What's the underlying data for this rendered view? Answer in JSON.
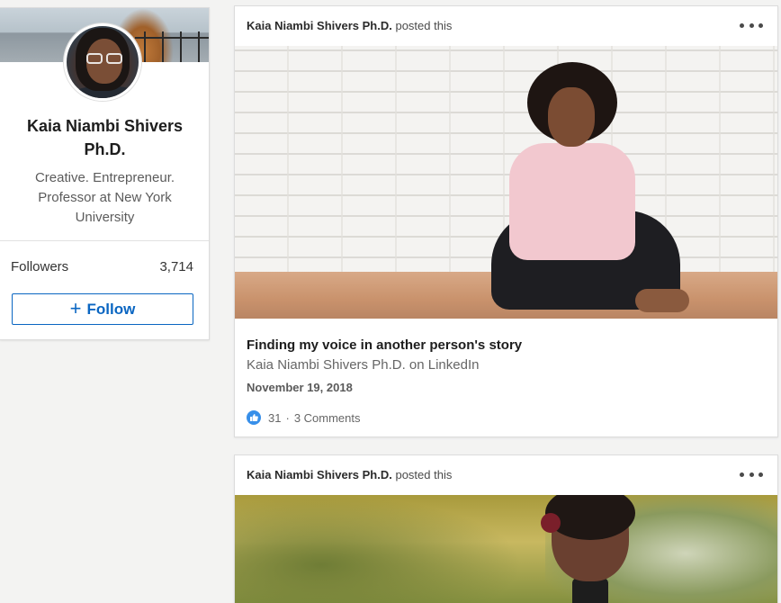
{
  "profile": {
    "name": "Kaia Niambi Shivers Ph.D.",
    "headline": "Creative. Entrepreneur. Professor at New York University",
    "followers_label": "Followers",
    "followers_count": "3,714",
    "follow_label": "Follow",
    "follow_icon": "plus-icon"
  },
  "posts": [
    {
      "author": "Kaia Niambi Shivers Ph.D.",
      "action": "posted this",
      "title": "Finding my voice in another person's story",
      "source": "Kaia Niambi Shivers Ph.D. on LinkedIn",
      "date": "November 19, 2018",
      "reactions": "31",
      "separator": "·",
      "comments": "3 Comments"
    },
    {
      "author": "Kaia Niambi Shivers Ph.D.",
      "action": "posted this"
    }
  ],
  "colors": {
    "accent": "#0a66c2",
    "like": "#378fe9",
    "background": "#f3f3f2"
  }
}
